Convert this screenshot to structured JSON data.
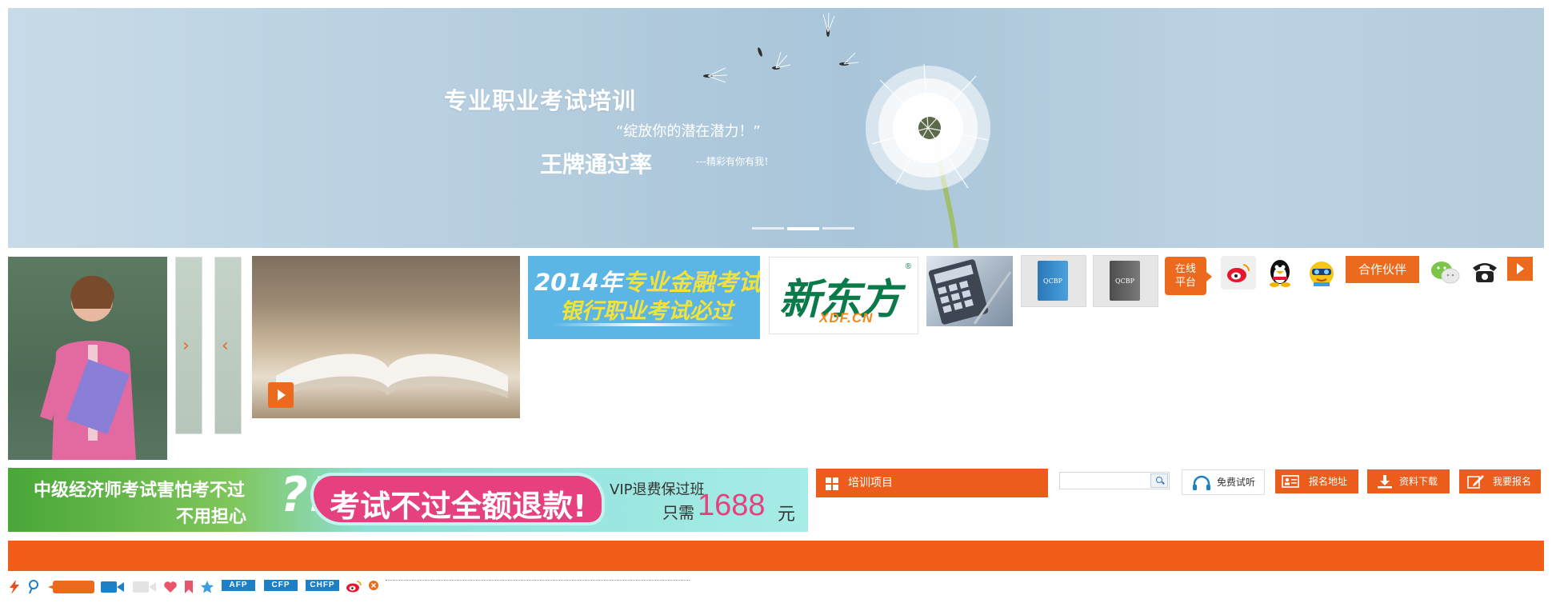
{
  "hero": {
    "title": "专业职业考试培训",
    "quote": "“绽放你的潜在潜力！”",
    "rate": "王牌通过率",
    "sign": "---精彩有你有我！",
    "slides": 3,
    "active_slide": 2
  },
  "thumbnails": {
    "finance_ad": {
      "line1_year": "2014年",
      "line1_rest": "专业金融考试",
      "line2": "银行职业考试必过"
    },
    "xdf_logo": {
      "cn": "新东方",
      "en": "XDF.CN",
      "mark": "®"
    },
    "qcbp_label": "QCBP",
    "online_platform": "在线平台",
    "partner": "合作伙伴"
  },
  "promo": {
    "left_text1": "中级经济师考试害怕考不过",
    "left_text2": "不用担心",
    "pink_text": "考试不过全额退款!",
    "vip": "VIP退费保过班",
    "price_pre": "只需",
    "price": "1688",
    "price_unit": "元"
  },
  "toolbar": {
    "training": "培训项目",
    "search_placeholder": "",
    "trial": "免费试听",
    "signup_address": "报名地址",
    "download": "资料下载",
    "register": "我要报名"
  },
  "bottom_tags": [
    "AFP",
    "CFP",
    "CHFP"
  ],
  "colors": {
    "accent": "#ec5c1b",
    "orange_bar": "#f25e1a",
    "tag_blue": "#1d7fc4",
    "finance_blue": "#5bb6e6",
    "xdf_green": "#0a7a4a",
    "promo_pink": "#e6407f"
  }
}
